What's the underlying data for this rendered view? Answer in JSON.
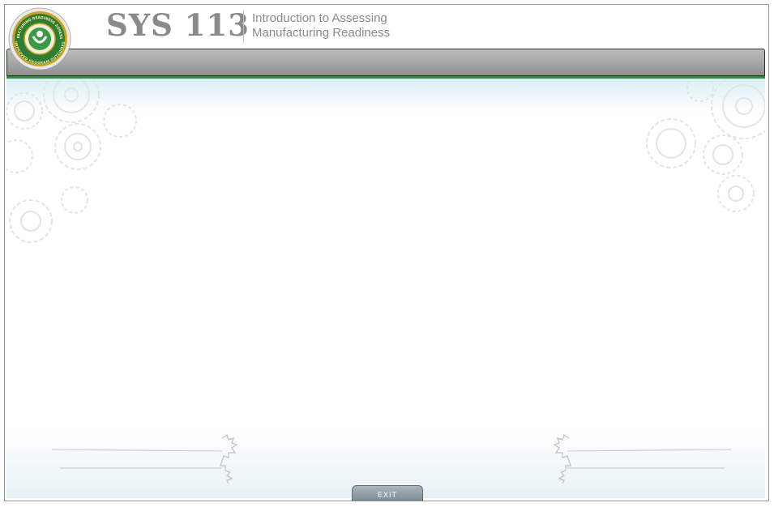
{
  "header": {
    "course_code": "SYS 113",
    "title_line1": "Introduction to Assessing",
    "title_line2": "Manufacturing Readiness",
    "logo_text_top": "MANUFACTURING READINESS ASSESSMENT",
    "logo_text_bottom": "IMPROVED PROGRAM OUTCOMES"
  },
  "footer": {
    "exit_label": "EXIT"
  },
  "colors": {
    "nav_bar": "#a3a3a3",
    "accent_stripe": "#2f8a3a",
    "logo_green": "#2e7d32",
    "logo_gold": "#c9a227",
    "title_gray": "#8a8a8a"
  }
}
